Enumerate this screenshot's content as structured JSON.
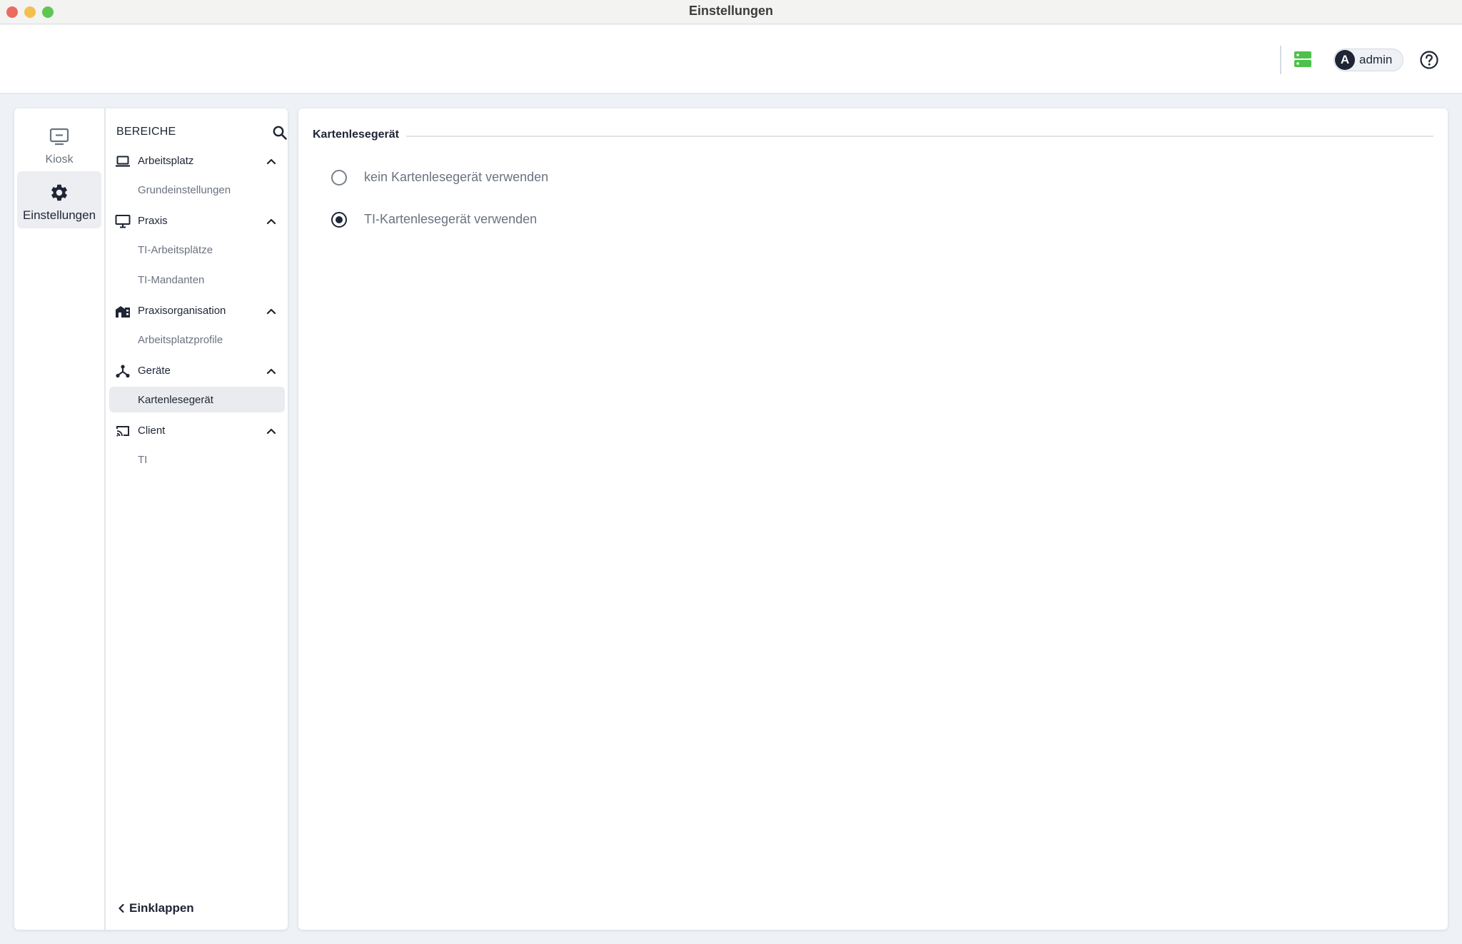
{
  "window": {
    "title": "Einstellungen"
  },
  "header": {
    "user": {
      "initial": "A",
      "name": "admin"
    }
  },
  "rail": {
    "items": [
      {
        "label": "Kiosk",
        "icon": "monitor-icon"
      },
      {
        "label": "Einstellungen",
        "icon": "gear-icon",
        "active": true
      }
    ]
  },
  "nav": {
    "heading": "BEREICHE",
    "groups": [
      {
        "label": "Arbeitsplatz",
        "icon": "laptop-icon",
        "expanded": true,
        "items": [
          "Grundeinstellungen"
        ]
      },
      {
        "label": "Praxis",
        "icon": "desktop-icon",
        "expanded": true,
        "items": [
          "TI-Arbeitsplätze",
          "TI-Mandanten"
        ]
      },
      {
        "label": "Praxisorganisation",
        "icon": "buildings-icon",
        "expanded": true,
        "items": [
          "Arbeitsplatzprofile"
        ]
      },
      {
        "label": "Geräte",
        "icon": "devices-hub-icon",
        "expanded": true,
        "items": [
          "Kartenlesegerät"
        ]
      },
      {
        "label": "Client",
        "icon": "cast-icon",
        "expanded": true,
        "items": [
          "TI"
        ]
      }
    ],
    "active_item": "Kartenlesegerät",
    "collapse_label": "Einklappen"
  },
  "main": {
    "section_title": "Kartenlesegerät",
    "options": [
      {
        "label": "kein Kartenlesegerät verwenden",
        "checked": false
      },
      {
        "label": "TI-Kartenlesegerät verwenden",
        "checked": true
      }
    ]
  },
  "colors": {
    "accent_dark": "#1e2535",
    "server_status_green": "#4cc24a",
    "muted_text": "#6b7380"
  }
}
